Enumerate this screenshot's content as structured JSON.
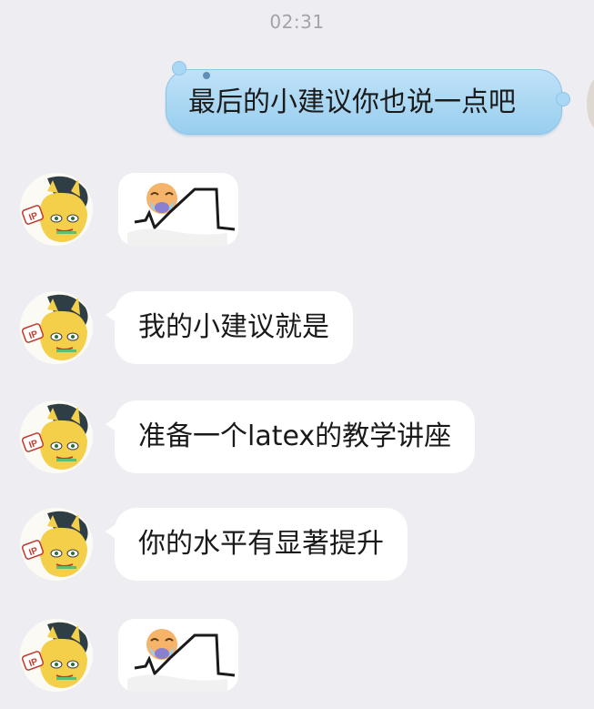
{
  "chat": {
    "timestamp": "02:31",
    "outgoing": {
      "text": "最后的小建议你也说一点吧"
    },
    "incoming": [
      {
        "type": "sticker",
        "icon": "crying-emoji-sticker"
      },
      {
        "type": "text",
        "text": "我的小建议就是"
      },
      {
        "type": "text",
        "text": "准备一个latex的教学讲座"
      },
      {
        "type": "text",
        "text": "你的水平有显著提升"
      },
      {
        "type": "sticker",
        "icon": "crying-emoji-sticker"
      }
    ]
  },
  "colors": {
    "background": "#eeeef2",
    "outgoing_bubble": "#a9d8f4",
    "incoming_bubble": "#ffffff",
    "timestamp": "#a3a3a8"
  }
}
